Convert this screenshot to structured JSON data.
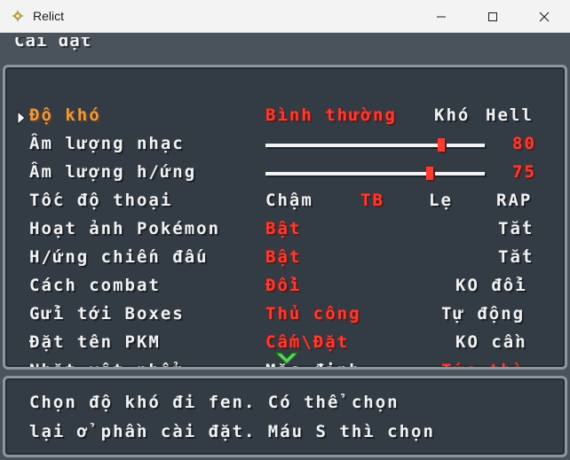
{
  "window": {
    "title": "Relict",
    "icon": "relict-app-icon",
    "controls": [
      "minimize-icon",
      "maximize-icon",
      "close-icon"
    ]
  },
  "screen": {
    "header": "Cài đặt"
  },
  "options": [
    {
      "label": "Độ khó",
      "active": true,
      "values": [
        "Bình thường",
        "Khó",
        "Hell"
      ],
      "selected": "Bình thường"
    },
    {
      "label": "Âm lượng nhạc",
      "type": "slider",
      "value": 80,
      "value_text": "80"
    },
    {
      "label": "Âm lượng h/ứng",
      "type": "slider",
      "value": 75,
      "value_text": "75"
    },
    {
      "label": "Tốc độ thoại",
      "values": [
        "Chậm",
        "TB",
        "Lẹ",
        "RAP"
      ],
      "selected": "TB"
    },
    {
      "label": "Hoạt ảnh Pokémon",
      "values": [
        "Bật",
        "Tắt"
      ],
      "selected": "Bật"
    },
    {
      "label": "H/ứng chiến đấu",
      "values": [
        "Bật",
        "Tắt"
      ],
      "selected": "Bật"
    },
    {
      "label": "Cách combat",
      "values": [
        "Đổi",
        "KO đổi"
      ],
      "selected": "Đổi"
    },
    {
      "label": "Gửi tới Boxes",
      "values": [
        "Thủ công",
        "Tự động"
      ],
      "selected": "Thủ công"
    },
    {
      "label": "Đặt tên PKM",
      "values": [
        "Cấm\\Đặt",
        "KO cần"
      ],
      "selected": "Cấm\\Đặt"
    },
    {
      "label": "Nhặt vật phẩm",
      "values": [
        "Mặc định",
        "Tức thì"
      ],
      "selected": "Tức thì"
    }
  ],
  "message": {
    "line1": "Chọn độ khó đi fen. Có thể chọn",
    "line2": "lại ở phần cài đặt. Máu S thì chọn"
  },
  "colors": {
    "background": "#4a535c",
    "panel": "#333b44",
    "panel_border": "#8d969f",
    "text": "#f2f2f2",
    "selected": "#ff3b2f",
    "active_label": "#e89b46",
    "scroll_arrow": "#5bd15b"
  }
}
